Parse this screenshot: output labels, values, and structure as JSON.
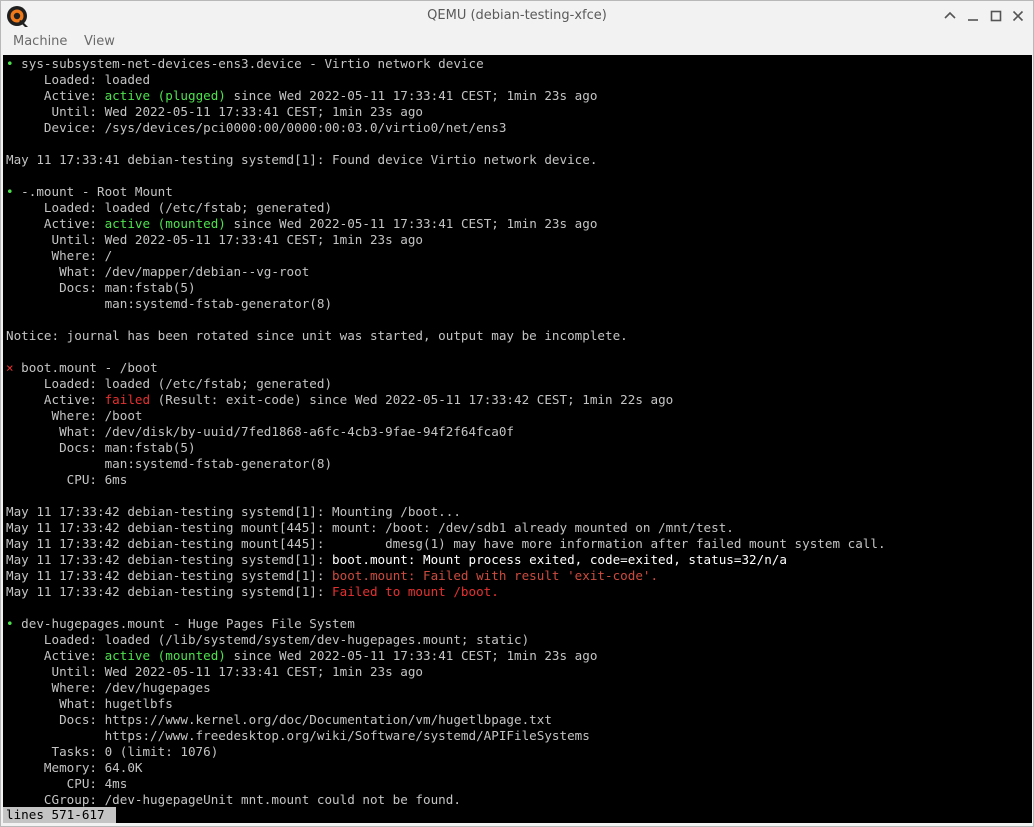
{
  "window": {
    "title": "QEMU (debian-testing-xfce)",
    "controls": [
      "minimize-up",
      "minimize",
      "maximize",
      "close"
    ]
  },
  "menu": {
    "items": [
      "Machine",
      "View"
    ]
  },
  "console": {
    "lines": [
      {
        "segs": [
          {
            "t": "• ",
            "c": "g"
          },
          {
            "t": "sys-subsystem-net-devices-ens3.device - Virtio network device"
          }
        ]
      },
      {
        "segs": [
          {
            "t": "     Loaded: loaded"
          }
        ]
      },
      {
        "segs": [
          {
            "t": "     Active: "
          },
          {
            "t": "active (plugged)",
            "c": "g"
          },
          {
            "t": " since Wed 2022-05-11 17:33:41 CEST; 1min 23s ago"
          }
        ]
      },
      {
        "segs": [
          {
            "t": "      Until: Wed 2022-05-11 17:33:41 CEST; 1min 23s ago"
          }
        ]
      },
      {
        "segs": [
          {
            "t": "     Device: /sys/devices/pci0000:00/0000:00:03.0/virtio0/net/ens3"
          }
        ]
      },
      {
        "segs": [
          {
            "t": ""
          }
        ]
      },
      {
        "segs": [
          {
            "t": "May 11 17:33:41 debian-testing systemd[1]: Found device Virtio network device."
          }
        ]
      },
      {
        "segs": [
          {
            "t": ""
          }
        ]
      },
      {
        "segs": [
          {
            "t": "• ",
            "c": "g"
          },
          {
            "t": "-.mount - Root Mount"
          }
        ]
      },
      {
        "segs": [
          {
            "t": "     Loaded: loaded (/etc/fstab; generated)"
          }
        ]
      },
      {
        "segs": [
          {
            "t": "     Active: "
          },
          {
            "t": "active (mounted)",
            "c": "g"
          },
          {
            "t": " since Wed 2022-05-11 17:33:41 CEST; 1min 23s ago"
          }
        ]
      },
      {
        "segs": [
          {
            "t": "      Until: Wed 2022-05-11 17:33:41 CEST; 1min 23s ago"
          }
        ]
      },
      {
        "segs": [
          {
            "t": "      Where: /"
          }
        ]
      },
      {
        "segs": [
          {
            "t": "       What: /dev/mapper/debian--vg-root"
          }
        ]
      },
      {
        "segs": [
          {
            "t": "       Docs: man:fstab(5)"
          }
        ]
      },
      {
        "segs": [
          {
            "t": "             man:systemd-fstab-generator(8)"
          }
        ]
      },
      {
        "segs": [
          {
            "t": ""
          }
        ]
      },
      {
        "segs": [
          {
            "t": "Notice: journal has been rotated since unit was started, output may be incomplete."
          }
        ]
      },
      {
        "segs": [
          {
            "t": ""
          }
        ]
      },
      {
        "segs": [
          {
            "t": "× ",
            "c": "r"
          },
          {
            "t": "boot.mount - /boot"
          }
        ]
      },
      {
        "segs": [
          {
            "t": "     Loaded: loaded (/etc/fstab; generated)"
          }
        ]
      },
      {
        "segs": [
          {
            "t": "     Active: "
          },
          {
            "t": "failed",
            "c": "r"
          },
          {
            "t": " (Result: exit-code) since Wed 2022-05-11 17:33:42 CEST; 1min 22s ago"
          }
        ]
      },
      {
        "segs": [
          {
            "t": "      Where: /boot"
          }
        ]
      },
      {
        "segs": [
          {
            "t": "       What: /dev/disk/by-uuid/7fed1868-a6fc-4cb3-9fae-94f2f64fca0f"
          }
        ]
      },
      {
        "segs": [
          {
            "t": "       Docs: man:fstab(5)"
          }
        ]
      },
      {
        "segs": [
          {
            "t": "             man:systemd-fstab-generator(8)"
          }
        ]
      },
      {
        "segs": [
          {
            "t": "        CPU: 6ms"
          }
        ]
      },
      {
        "segs": [
          {
            "t": ""
          }
        ]
      },
      {
        "segs": [
          {
            "t": "May 11 17:33:42 debian-testing systemd[1]: Mounting /boot..."
          }
        ]
      },
      {
        "segs": [
          {
            "t": "May 11 17:33:42 debian-testing mount[445]: mount: /boot: /dev/sdb1 already mounted on /mnt/test."
          }
        ]
      },
      {
        "segs": [
          {
            "t": "May 11 17:33:42 debian-testing mount[445]:        dmesg(1) may have more information after failed mount system call."
          }
        ]
      },
      {
        "segs": [
          {
            "t": "May 11 17:33:42 debian-testing systemd[1]: "
          },
          {
            "t": "boot.mount: Mount process exited, code=exited, status=32/n/a",
            "c": "w"
          }
        ]
      },
      {
        "segs": [
          {
            "t": "May 11 17:33:42 debian-testing systemd[1]: "
          },
          {
            "t": "boot.mount: Failed with result 'exit-code'.",
            "c": "rd"
          }
        ]
      },
      {
        "segs": [
          {
            "t": "May 11 17:33:42 debian-testing systemd[1]: "
          },
          {
            "t": "Failed to mount /boot.",
            "c": "r"
          }
        ]
      },
      {
        "segs": [
          {
            "t": ""
          }
        ]
      },
      {
        "segs": [
          {
            "t": "• ",
            "c": "g"
          },
          {
            "t": "dev-hugepages.mount - Huge Pages File System"
          }
        ]
      },
      {
        "segs": [
          {
            "t": "     Loaded: loaded (/lib/systemd/system/dev-hugepages.mount; static)"
          }
        ]
      },
      {
        "segs": [
          {
            "t": "     Active: "
          },
          {
            "t": "active (mounted)",
            "c": "g"
          },
          {
            "t": " since Wed 2022-05-11 17:33:41 CEST; 1min 23s ago"
          }
        ]
      },
      {
        "segs": [
          {
            "t": "      Until: Wed 2022-05-11 17:33:41 CEST; 1min 23s ago"
          }
        ]
      },
      {
        "segs": [
          {
            "t": "      Where: /dev/hugepages"
          }
        ]
      },
      {
        "segs": [
          {
            "t": "       What: hugetlbfs"
          }
        ]
      },
      {
        "segs": [
          {
            "t": "       Docs: https://www.kernel.org/doc/Documentation/vm/hugetlbpage.txt"
          }
        ]
      },
      {
        "segs": [
          {
            "t": "             https://www.freedesktop.org/wiki/Software/systemd/APIFileSystems"
          }
        ]
      },
      {
        "segs": [
          {
            "t": "      Tasks: 0 (limit: 1076)"
          }
        ]
      },
      {
        "segs": [
          {
            "t": "     Memory: 64.0K"
          }
        ]
      },
      {
        "segs": [
          {
            "t": "        CPU: 4ms"
          }
        ]
      },
      {
        "segs": [
          {
            "t": "     CGroup: /dev-hugepageUnit mnt.mount could not be found."
          }
        ]
      }
    ],
    "pager_status": "lines 571-617"
  },
  "colors": {
    "active_green": "#4ee14e",
    "failed_red": "#e63030",
    "console_bg": "#000000",
    "console_fg": "#c4c4c4"
  }
}
